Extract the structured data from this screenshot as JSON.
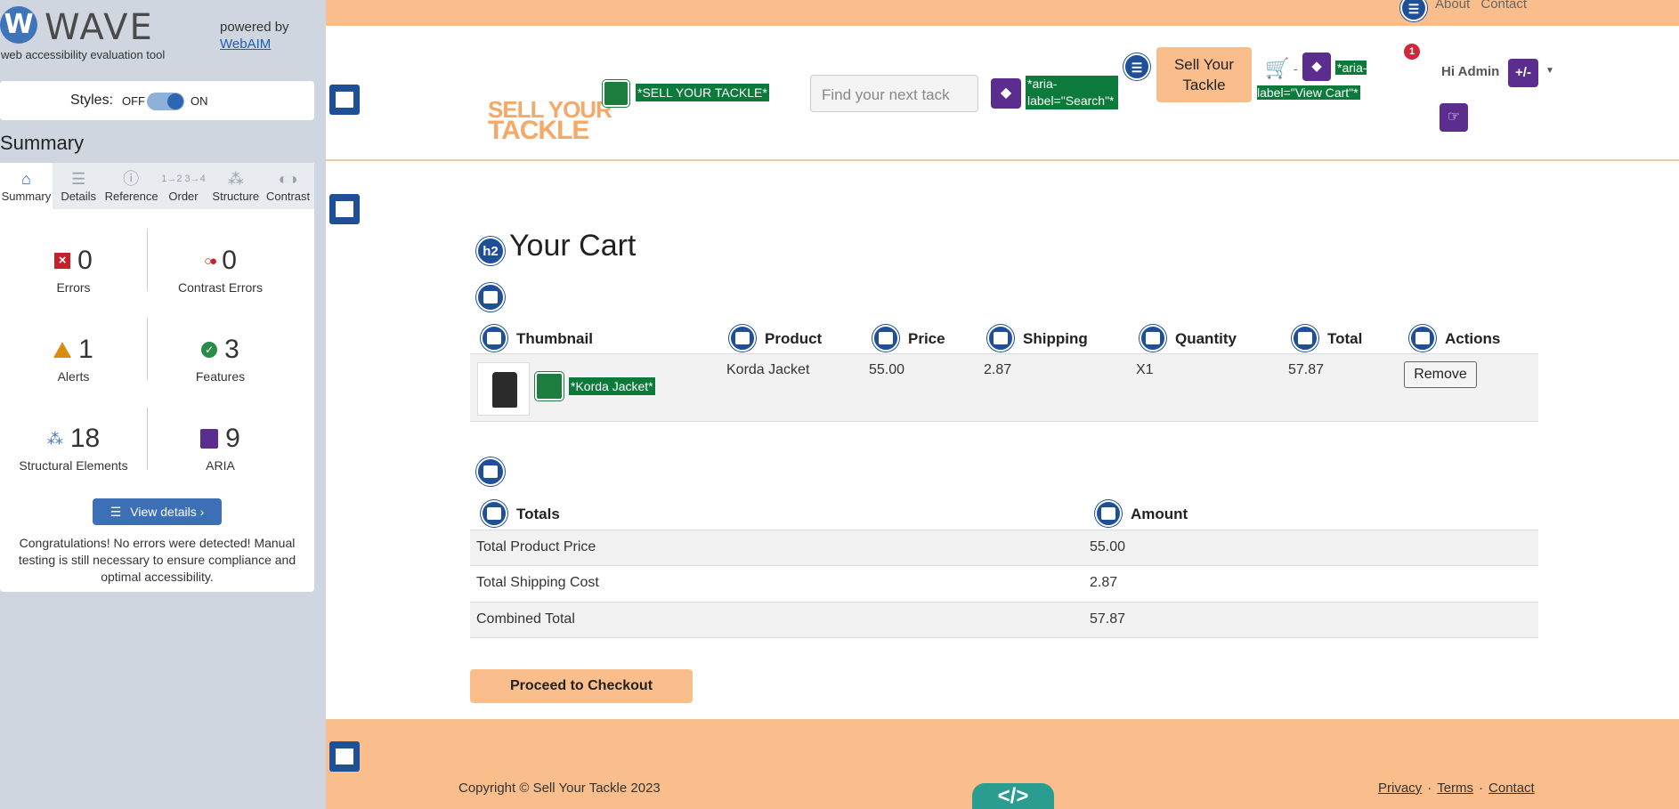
{
  "wave": {
    "logo_letter": "W",
    "logo_text": "WAVE",
    "tagline": "web accessibility evaluation tool",
    "powered_by": "powered by",
    "webaim_link": "WebAIM",
    "styles_label": "Styles:",
    "styles_off": "OFF",
    "styles_on": "ON",
    "summary_title": "Summary",
    "tabs": [
      {
        "label": "Summary",
        "icon": "home-icon"
      },
      {
        "label": "Details",
        "icon": "list-icon"
      },
      {
        "label": "Reference",
        "icon": "info-icon"
      },
      {
        "label": "Order",
        "icon": "order-icon"
      },
      {
        "label": "Structure",
        "icon": "structure-icon"
      },
      {
        "label": "Contrast",
        "icon": "contrast-icon"
      }
    ],
    "stats": {
      "errors": {
        "count": "0",
        "label": "Errors"
      },
      "contrast_errors": {
        "count": "0",
        "label": "Contrast Errors"
      },
      "alerts": {
        "count": "1",
        "label": "Alerts"
      },
      "features": {
        "count": "3",
        "label": "Features"
      },
      "structural": {
        "count": "18",
        "label": "Structural Elements"
      },
      "aria": {
        "count": "9",
        "label": "ARIA"
      }
    },
    "view_details": "View details ›",
    "congrats": "Congratulations! No errors were detected! Manual testing is still necessary to ensure compliance and optimal accessibility."
  },
  "site": {
    "topbar_links": [
      "About",
      "Contact"
    ],
    "logo_line1": "SELL YOUR",
    "logo_line2": "TACKLE",
    "logo_alt": "*SELL YOUR TACKLE*",
    "search_placeholder": "Find your next tack",
    "search_aria": "*aria-label=\"Search\"*",
    "sell_button": "Sell Your Tackle",
    "cart_dash": "-",
    "cart_aria": "*aria-label=\"View Cart\"*",
    "badge_count": "1",
    "greeting": "Hi Admin",
    "aria_plusminus": "+/-"
  },
  "cart": {
    "heading_tag": "h2",
    "title": "Your Cart",
    "columns": [
      "Thumbnail",
      "Product",
      "Price",
      "Shipping",
      "Quantity",
      "Total",
      "Actions"
    ],
    "items": [
      {
        "image_alt": "*Korda Jacket*",
        "product": "Korda Jacket",
        "price": "55.00",
        "shipping": "2.87",
        "quantity": "X1",
        "total": "57.87",
        "action": "Remove"
      }
    ],
    "totals_header": "Totals",
    "amount_header": "Amount",
    "totals": [
      {
        "label": "Total Product Price",
        "value": "55.00"
      },
      {
        "label": "Total Shipping Cost",
        "value": "2.87"
      },
      {
        "label": "Combined Total",
        "value": "57.87"
      }
    ],
    "checkout": "Proceed to Checkout"
  },
  "footer": {
    "copyright": "Copyright © Sell Your Tackle 2023",
    "links": [
      "Privacy",
      "Terms",
      "Contact"
    ],
    "code_label": "</>"
  },
  "colors": {
    "accent_orange": "#f9be8b",
    "wave_blue": "#1f4f96",
    "aria_purple": "#5b2d8e",
    "feature_green": "#0b7a3a"
  }
}
